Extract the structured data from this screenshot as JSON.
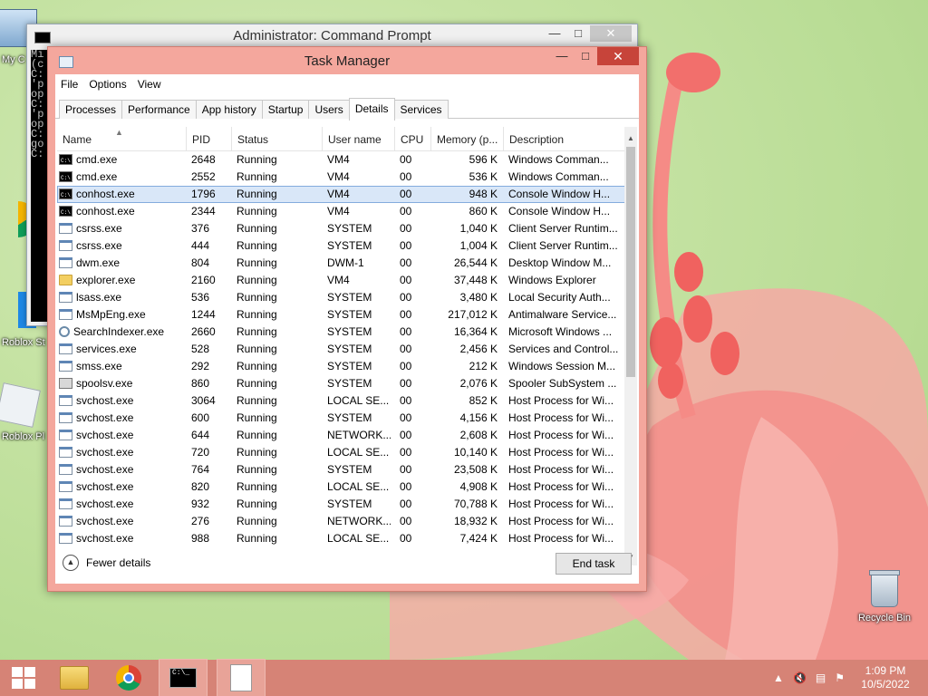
{
  "desktop": {
    "icons_left": [
      "My C",
      "Roblox St",
      "Roblox Pl"
    ],
    "recycle_bin": "Recycle Bin"
  },
  "cmd_window": {
    "title": "Administrator: Command Prompt",
    "lines": [
      "Mi",
      "(c",
      "",
      "C:",
      "'p",
      "op",
      "",
      "C:",
      "'p",
      "op",
      "",
      "C:",
      "go",
      "",
      "C:"
    ]
  },
  "task_manager": {
    "title": "Task Manager",
    "menu": [
      "File",
      "Options",
      "View"
    ],
    "tabs": [
      "Processes",
      "Performance",
      "App history",
      "Startup",
      "Users",
      "Details",
      "Services"
    ],
    "active_tab": "Details",
    "columns": [
      "Name",
      "PID",
      "Status",
      "User name",
      "CPU",
      "Memory (p...",
      "Description"
    ],
    "rows": [
      {
        "icon": "cmd",
        "name": "cmd.exe",
        "pid": "2648",
        "status": "Running",
        "user": "VM4",
        "cpu": "00",
        "mem": "596 K",
        "desc": "Windows Comman..."
      },
      {
        "icon": "cmd",
        "name": "cmd.exe",
        "pid": "2552",
        "status": "Running",
        "user": "VM4",
        "cpu": "00",
        "mem": "536 K",
        "desc": "Windows Comman..."
      },
      {
        "icon": "cmd",
        "name": "conhost.exe",
        "pid": "1796",
        "status": "Running",
        "user": "VM4",
        "cpu": "00",
        "mem": "948 K",
        "desc": "Console Window H...",
        "selected": true
      },
      {
        "icon": "cmd",
        "name": "conhost.exe",
        "pid": "2344",
        "status": "Running",
        "user": "VM4",
        "cpu": "00",
        "mem": "860 K",
        "desc": "Console Window H..."
      },
      {
        "icon": "gen",
        "name": "csrss.exe",
        "pid": "376",
        "status": "Running",
        "user": "SYSTEM",
        "cpu": "00",
        "mem": "1,040 K",
        "desc": "Client Server Runtim..."
      },
      {
        "icon": "gen",
        "name": "csrss.exe",
        "pid": "444",
        "status": "Running",
        "user": "SYSTEM",
        "cpu": "00",
        "mem": "1,004 K",
        "desc": "Client Server Runtim..."
      },
      {
        "icon": "gen",
        "name": "dwm.exe",
        "pid": "804",
        "status": "Running",
        "user": "DWM-1",
        "cpu": "00",
        "mem": "26,544 K",
        "desc": "Desktop Window M..."
      },
      {
        "icon": "folder",
        "name": "explorer.exe",
        "pid": "2160",
        "status": "Running",
        "user": "VM4",
        "cpu": "00",
        "mem": "37,448 K",
        "desc": "Windows Explorer"
      },
      {
        "icon": "gen",
        "name": "lsass.exe",
        "pid": "536",
        "status": "Running",
        "user": "SYSTEM",
        "cpu": "00",
        "mem": "3,480 K",
        "desc": "Local Security Auth..."
      },
      {
        "icon": "gen",
        "name": "MsMpEng.exe",
        "pid": "1244",
        "status": "Running",
        "user": "SYSTEM",
        "cpu": "00",
        "mem": "217,012 K",
        "desc": "Antimalware Service..."
      },
      {
        "icon": "search",
        "name": "SearchIndexer.exe",
        "pid": "2660",
        "status": "Running",
        "user": "SYSTEM",
        "cpu": "00",
        "mem": "16,364 K",
        "desc": "Microsoft Windows ..."
      },
      {
        "icon": "gen",
        "name": "services.exe",
        "pid": "528",
        "status": "Running",
        "user": "SYSTEM",
        "cpu": "00",
        "mem": "2,456 K",
        "desc": "Services and Control..."
      },
      {
        "icon": "gen",
        "name": "smss.exe",
        "pid": "292",
        "status": "Running",
        "user": "SYSTEM",
        "cpu": "00",
        "mem": "212 K",
        "desc": "Windows Session M..."
      },
      {
        "icon": "printer",
        "name": "spoolsv.exe",
        "pid": "860",
        "status": "Running",
        "user": "SYSTEM",
        "cpu": "00",
        "mem": "2,076 K",
        "desc": "Spooler SubSystem ..."
      },
      {
        "icon": "gen",
        "name": "svchost.exe",
        "pid": "3064",
        "status": "Running",
        "user": "LOCAL SE...",
        "cpu": "00",
        "mem": "852 K",
        "desc": "Host Process for Wi..."
      },
      {
        "icon": "gen",
        "name": "svchost.exe",
        "pid": "600",
        "status": "Running",
        "user": "SYSTEM",
        "cpu": "00",
        "mem": "4,156 K",
        "desc": "Host Process for Wi..."
      },
      {
        "icon": "gen",
        "name": "svchost.exe",
        "pid": "644",
        "status": "Running",
        "user": "NETWORK...",
        "cpu": "00",
        "mem": "2,608 K",
        "desc": "Host Process for Wi..."
      },
      {
        "icon": "gen",
        "name": "svchost.exe",
        "pid": "720",
        "status": "Running",
        "user": "LOCAL SE...",
        "cpu": "00",
        "mem": "10,140 K",
        "desc": "Host Process for Wi..."
      },
      {
        "icon": "gen",
        "name": "svchost.exe",
        "pid": "764",
        "status": "Running",
        "user": "SYSTEM",
        "cpu": "00",
        "mem": "23,508 K",
        "desc": "Host Process for Wi..."
      },
      {
        "icon": "gen",
        "name": "svchost.exe",
        "pid": "820",
        "status": "Running",
        "user": "LOCAL SE...",
        "cpu": "00",
        "mem": "4,908 K",
        "desc": "Host Process for Wi..."
      },
      {
        "icon": "gen",
        "name": "svchost.exe",
        "pid": "932",
        "status": "Running",
        "user": "SYSTEM",
        "cpu": "00",
        "mem": "70,788 K",
        "desc": "Host Process for Wi..."
      },
      {
        "icon": "gen",
        "name": "svchost.exe",
        "pid": "276",
        "status": "Running",
        "user": "NETWORK...",
        "cpu": "00",
        "mem": "18,932 K",
        "desc": "Host Process for Wi..."
      },
      {
        "icon": "gen",
        "name": "svchost.exe",
        "pid": "988",
        "status": "Running",
        "user": "LOCAL SE...",
        "cpu": "00",
        "mem": "7,424 K",
        "desc": "Host Process for Wi..."
      }
    ],
    "fewer_details": "Fewer details",
    "end_task": "End task"
  },
  "taskbar": {
    "time": "1:09 PM",
    "date": "10/5/2022",
    "cmd_icon_text": "C:\\_"
  },
  "colors": {
    "accent": "#f4a79d",
    "taskbar": "#d68376",
    "selection": "#d9e7f8",
    "close_button": "#c7443a"
  }
}
